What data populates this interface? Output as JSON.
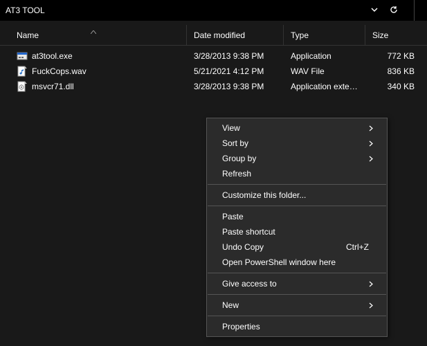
{
  "window": {
    "title": "AT3 TOOL"
  },
  "columns": {
    "name": "Name",
    "date": "Date modified",
    "type": "Type",
    "size": "Size"
  },
  "files": [
    {
      "icon": "exe-icon",
      "name": "at3tool.exe",
      "date": "3/28/2013 9:38 PM",
      "type": "Application",
      "size": "772 KB"
    },
    {
      "icon": "wav-icon",
      "name": "FuckCops.wav",
      "date": "5/21/2021 4:12 PM",
      "type": "WAV File",
      "size": "836 KB"
    },
    {
      "icon": "dll-icon",
      "name": "msvcr71.dll",
      "date": "3/28/2013 9:38 PM",
      "type": "Application exten...",
      "size": "340 KB"
    }
  ],
  "context_menu": {
    "view": "View",
    "sort_by": "Sort by",
    "group_by": "Group by",
    "refresh": "Refresh",
    "customize": "Customize this folder...",
    "paste": "Paste",
    "paste_shortcut": "Paste shortcut",
    "undo_copy": "Undo Copy",
    "undo_copy_shortcut": "Ctrl+Z",
    "open_powershell": "Open PowerShell window here",
    "give_access": "Give access to",
    "new": "New",
    "properties": "Properties"
  }
}
